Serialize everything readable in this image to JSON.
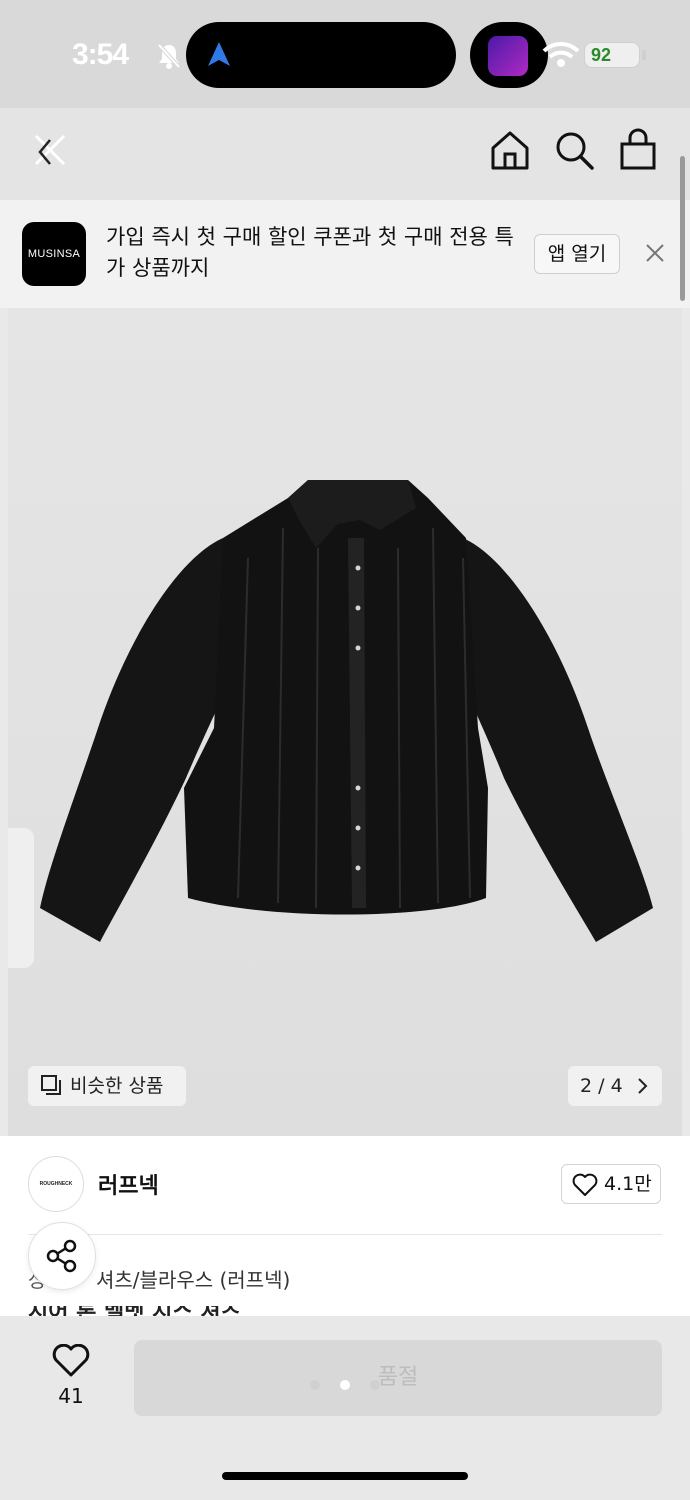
{
  "status_bar": {
    "time": "3:54",
    "battery": "92"
  },
  "banner": {
    "logo_text": "MUSINSA",
    "message": "가입 즉시 첫 구매 할인 쿠폰과 첫 구매 전용 특가 상품까지",
    "open_label": "앱 열기"
  },
  "gallery": {
    "similar_label": "비슷한 상품",
    "counter": "2 / 4"
  },
  "product": {
    "brand_logo_text": "ROUGHNECK",
    "brand_name": "러프넥",
    "like_count": "4.1만",
    "category_prefix": "상",
    "category": "셔츠/블라우스 (러프넥)",
    "title": "시어 톤 벨벳 시스 셔츠"
  },
  "bottom_bar": {
    "wish_count": "41",
    "soldout_label": "품절"
  },
  "colors": {
    "brand_black": "#000000",
    "soldout_bg": "#d8d8d8"
  }
}
